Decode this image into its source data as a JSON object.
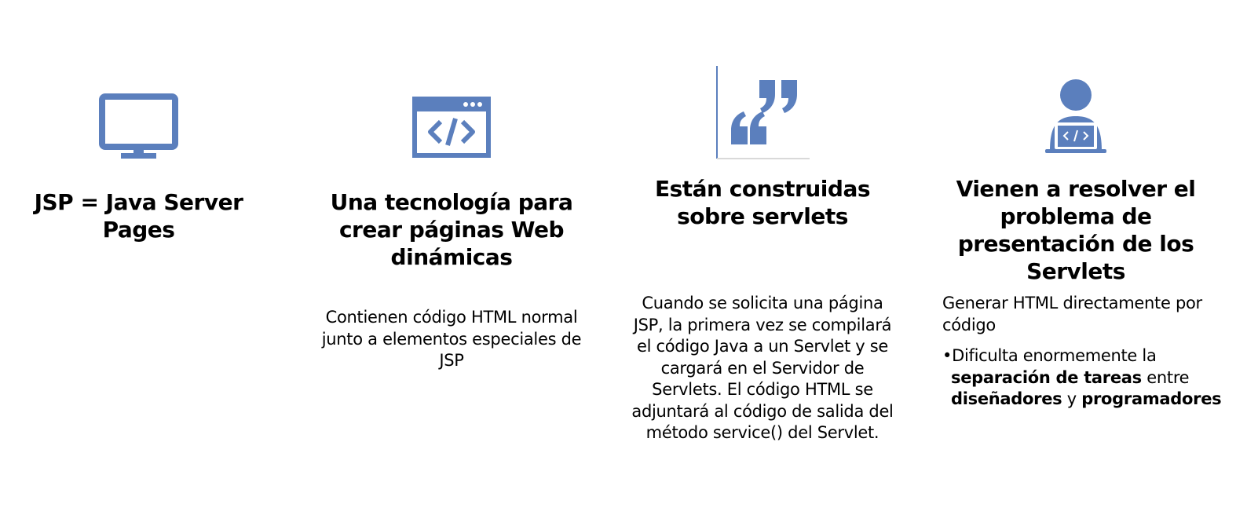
{
  "columns": [
    {
      "icon": "monitor-icon",
      "title": "JSP = Java Server Pages"
    },
    {
      "icon": "code-window-icon",
      "title": "Una tecnología para crear páginas Web dinámicas",
      "body": "Contienen código HTML normal junto a elementos especiales de JSP"
    },
    {
      "icon": "quote-icon",
      "title": "Están construidas sobre servlets",
      "body": "Cuando se solicita una página JSP, la primera vez se compilará el código Java a un Servlet y se cargará en el Servidor de Servlets. El código HTML se adjuntará al código de salida del método service() del Servlet."
    },
    {
      "icon": "programmer-icon",
      "title": "Vienen a resolver el problema de presentación de los Servlets",
      "body": "Generar HTML directamente por código",
      "bullet": {
        "marker": "•",
        "part1": "Dificulta enormemente la",
        "bold1": "separación de tareas",
        "part2": " entre",
        "bold2": "diseñadores",
        "part3": " y ",
        "bold3": "programadores"
      }
    }
  ],
  "colors": {
    "icon": "#5B7FBD",
    "text": "#000000"
  }
}
